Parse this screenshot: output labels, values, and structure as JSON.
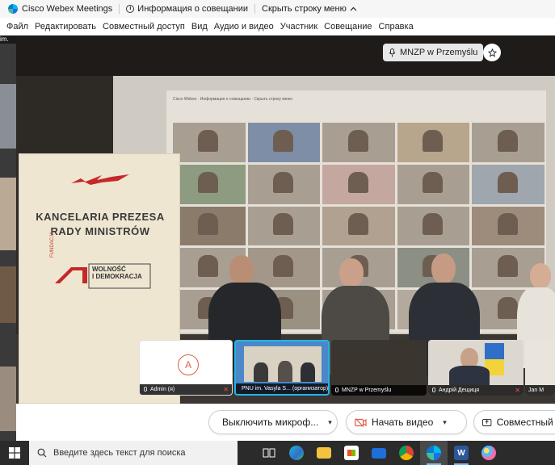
{
  "titlebar": {
    "app_name": "Cisco Webex Meetings",
    "meeting_info": "Информация о совещании",
    "hide_menu": "Скрыть строку меню"
  },
  "menubar": {
    "items": [
      "Файл",
      "Редактировать",
      "Совместный доступ",
      "Вид",
      "Аудио и видео",
      "Участник",
      "Совещание",
      "Справка"
    ]
  },
  "left_strip": {
    "fragment": "im."
  },
  "stage": {
    "active_speaker": "MNZP w Przemyślu",
    "banner": {
      "line1": "KANCELARIA PREZESA",
      "line2": "RADY MINISTRÓW",
      "fund_label": "FUNDACJA",
      "logo_line1": "WOLNOŚĆ",
      "logo_line2": "I DEMOKRACJA"
    }
  },
  "thumbnails": [
    {
      "name": "Admin (я)",
      "avatar_letter": "A",
      "muted": true
    },
    {
      "name": "PNU im. Vasyla S... (организатор)",
      "muted": false
    },
    {
      "name": "MNZP w Przemyślu",
      "muted": false
    },
    {
      "name": "Андрій Дещиця",
      "muted": true
    },
    {
      "name": "Jan M",
      "muted": false
    }
  ],
  "controls": {
    "mute_label": "Выключить микроф...",
    "video_label": "Начать видео",
    "share_label": "Совместный д"
  },
  "taskbar": {
    "search_placeholder": "Введите здесь текст для поиска",
    "apps": [
      "task-view",
      "edge",
      "file-explorer",
      "store",
      "mail",
      "chrome",
      "webex",
      "word",
      "paint"
    ]
  },
  "colors": {
    "accent_red": "#e25b45",
    "mute_red": "#ff4d4d",
    "taskbar": "#2b2b2b",
    "webex_blue": "#00bceb"
  }
}
